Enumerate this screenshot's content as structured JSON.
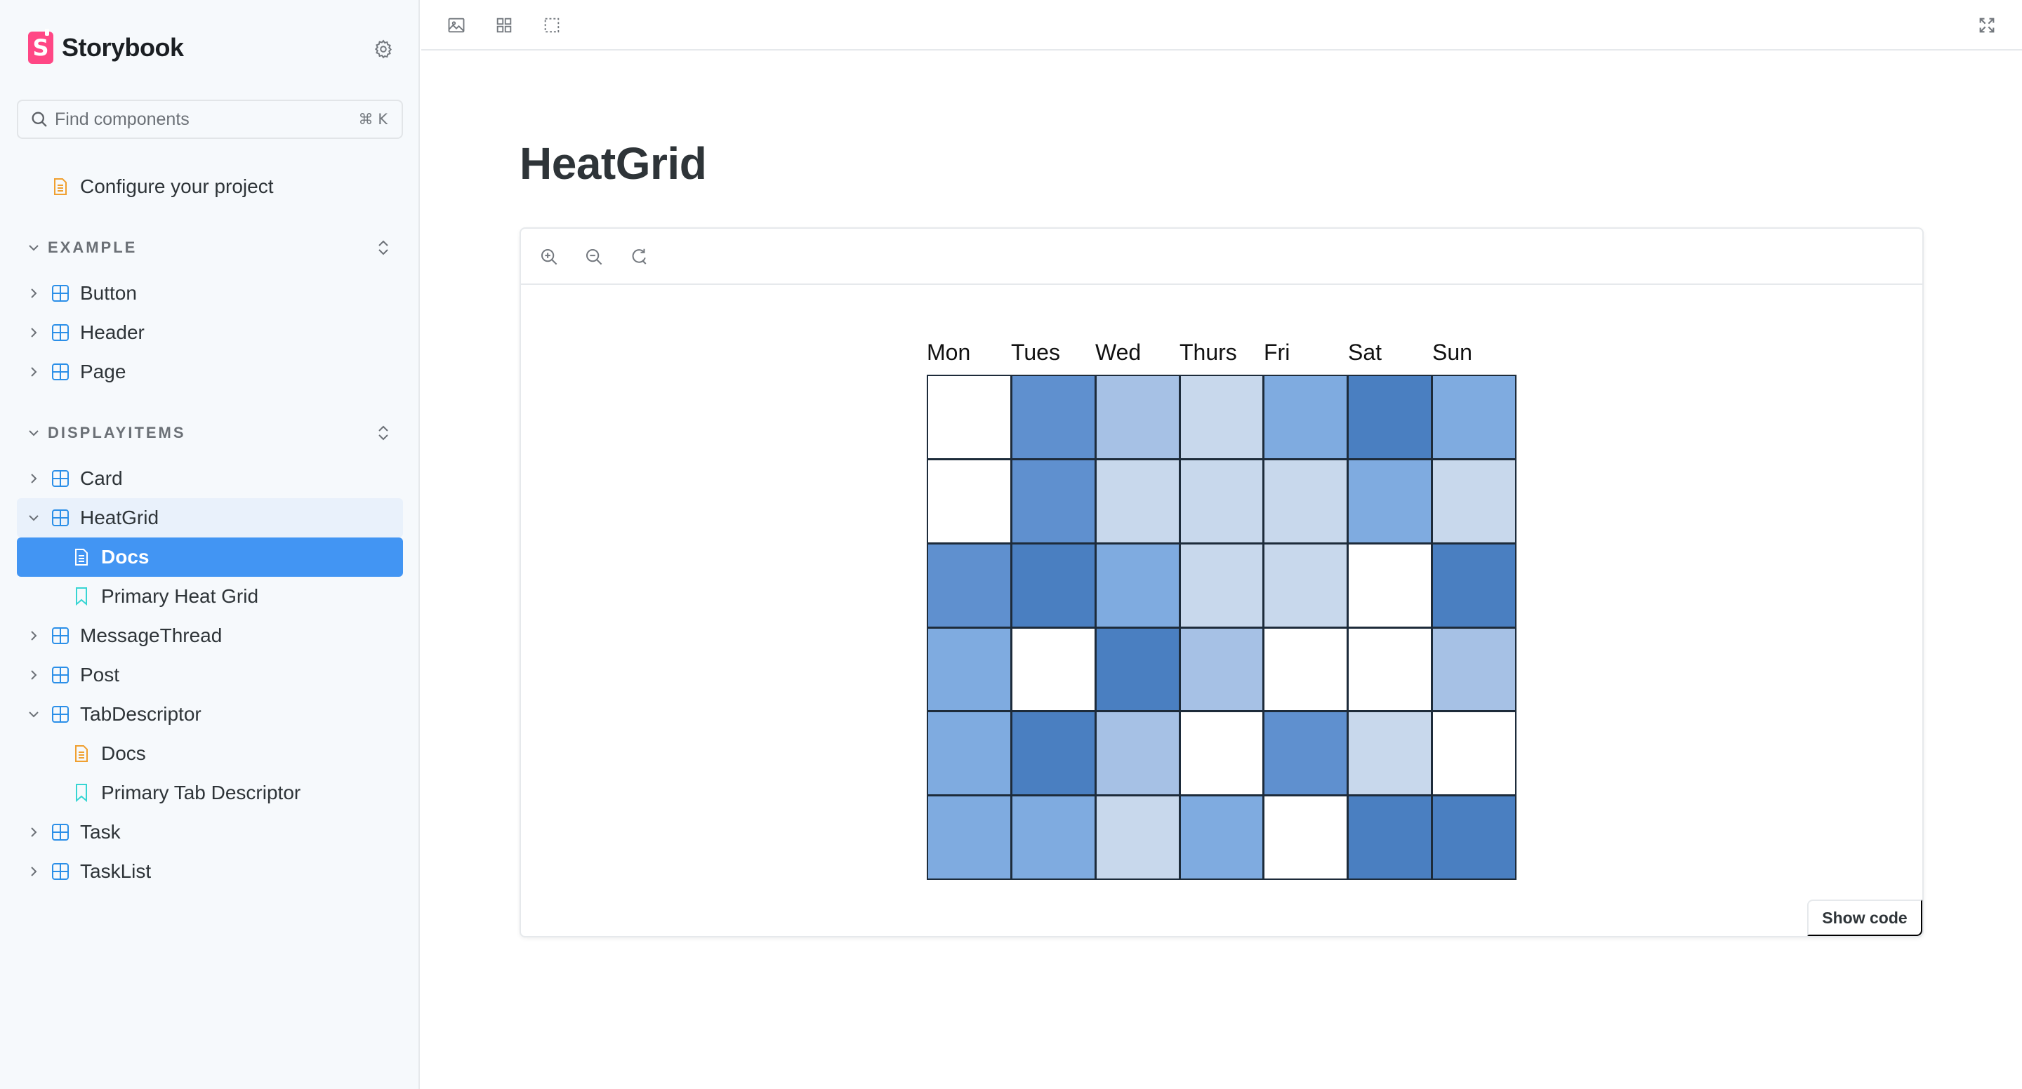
{
  "app": {
    "name": "Storybook"
  },
  "search": {
    "placeholder": "Find components",
    "shortcut": "⌘ K"
  },
  "sidebar": {
    "top_item": {
      "label": "Configure your project",
      "icon": "document-icon"
    },
    "sections": [
      {
        "title": "EXAMPLE",
        "items": [
          {
            "label": "Button"
          },
          {
            "label": "Header"
          },
          {
            "label": "Page"
          }
        ]
      },
      {
        "title": "DISPLAYITEMS",
        "items": [
          {
            "label": "Card"
          },
          {
            "label": "HeatGrid",
            "children": [
              {
                "label": "Docs"
              },
              {
                "label": "Primary Heat Grid"
              }
            ]
          },
          {
            "label": "MessageThread"
          },
          {
            "label": "Post"
          },
          {
            "label": "TabDescriptor",
            "children": [
              {
                "label": "Docs"
              },
              {
                "label": "Primary Tab Descriptor"
              }
            ]
          },
          {
            "label": "Task"
          },
          {
            "label": "TaskList"
          }
        ]
      }
    ]
  },
  "page": {
    "title": "HeatGrid"
  },
  "preview": {
    "show_code_label": "Show code"
  },
  "heatgrid": {
    "days": [
      "Mon",
      "Tues",
      "Wed",
      "Thurs",
      "Fri",
      "Sat",
      "Sun"
    ],
    "palette": [
      "#ffffff",
      "#c8d8ec",
      "#a6c1e5",
      "#7fabe0",
      "#5f90cf",
      "#4a7fc1"
    ],
    "levels": [
      [
        0,
        4,
        2,
        1,
        3,
        5,
        3
      ],
      [
        0,
        4,
        1,
        1,
        1,
        3,
        1
      ],
      [
        4,
        5,
        3,
        1,
        1,
        0,
        5
      ],
      [
        3,
        0,
        5,
        2,
        0,
        0,
        2
      ],
      [
        3,
        5,
        2,
        0,
        4,
        1,
        0
      ],
      [
        3,
        3,
        1,
        3,
        0,
        5,
        5
      ]
    ]
  }
}
